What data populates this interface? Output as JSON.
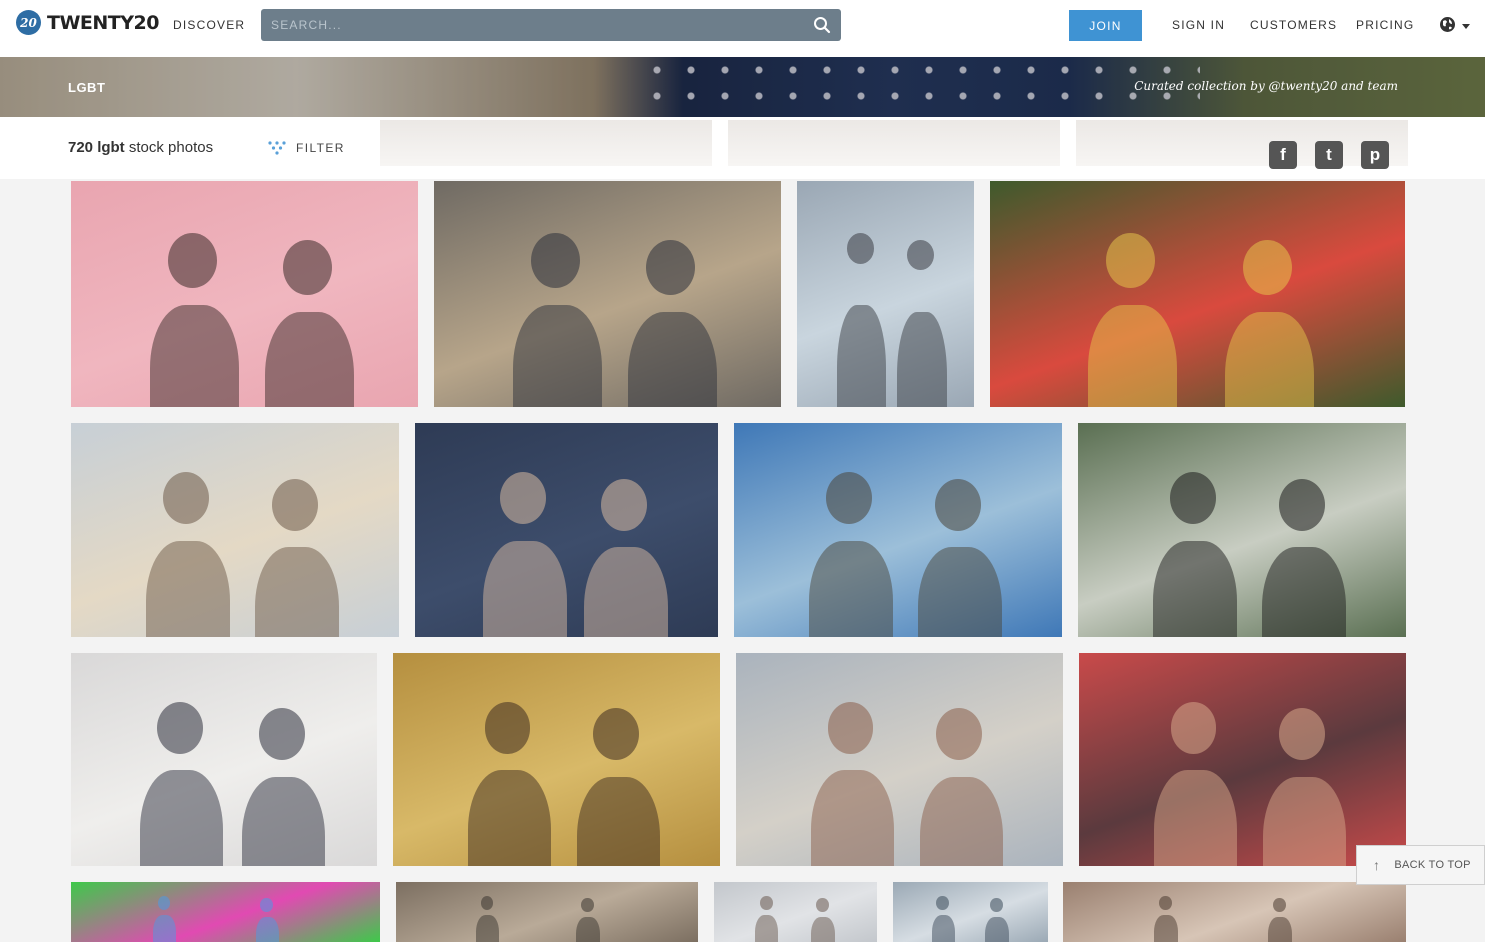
{
  "nav": {
    "logo_badge": "20",
    "logo_text": "TWENTY20",
    "discover": "DISCOVER",
    "search_placeholder": "SEARCH...",
    "join": "JOIN",
    "sign_in": "SIGN IN",
    "customers": "CUSTOMERS",
    "pricing": "PRICING"
  },
  "banner": {
    "title": "LGBT",
    "credit": "Curated collection by @twenty20 and team"
  },
  "subbar": {
    "count": "720 lgbt",
    "count_suffix": "stock photos",
    "filter": "FILTER",
    "social": [
      {
        "name": "facebook",
        "glyph": "f"
      },
      {
        "name": "twitter",
        "glyph": "t"
      },
      {
        "name": "pinterest",
        "glyph": "p"
      }
    ]
  },
  "back_to_top": "BACK TO TOP",
  "photos": [
    {
      "name": "photo-couple-pink-wall",
      "colors": [
        "#e9a5b0",
        "#f0b6bf",
        "#3a2a28"
      ]
    },
    {
      "name": "photo-couple-cafe",
      "colors": [
        "#6f6a63",
        "#b7a58a",
        "#2c2f3a"
      ]
    },
    {
      "name": "photo-portrait-glasses",
      "colors": [
        "#9aa7b4",
        "#c9d5de",
        "#3a3d44"
      ]
    },
    {
      "name": "photo-pride-crowd",
      "colors": [
        "#3e5a2c",
        "#d94a3e",
        "#e6c34a"
      ]
    },
    {
      "name": "photo-couple-coast",
      "colors": [
        "#c7cfd6",
        "#e4d9c5",
        "#6d5a48"
      ]
    },
    {
      "name": "photo-kiss-blue-wall",
      "colors": [
        "#2e3b55",
        "#3d4d6b",
        "#d7b9a1"
      ]
    },
    {
      "name": "photo-couple-sunset",
      "colors": [
        "#3f78b7",
        "#9cbfd9",
        "#4a463a"
      ]
    },
    {
      "name": "photo-grooms-tuxedo",
      "colors": [
        "#5a6f52",
        "#c8cdc2",
        "#1c1c1c"
      ]
    },
    {
      "name": "photo-party-balloons",
      "colors": [
        "#d9d8d8",
        "#efeeec",
        "#2e2f3d"
      ]
    },
    {
      "name": "photo-couple-field",
      "colors": [
        "#b58f3f",
        "#d8b968",
        "#3e2b20"
      ]
    },
    {
      "name": "photo-pride-parade-woman",
      "colors": [
        "#aab3bd",
        "#d4d0c8",
        "#8a5e4a"
      ]
    },
    {
      "name": "photo-bold-arm",
      "colors": [
        "#c94a4a",
        "#5b3a3e",
        "#d7a88a"
      ]
    },
    {
      "name": "photo-painted-hands",
      "colors": [
        "#3ec94a",
        "#e14ab2",
        "#4a9be3"
      ]
    },
    {
      "name": "photo-street-crowd",
      "colors": [
        "#7c6f61",
        "#b9aa98",
        "#3a3530"
      ]
    },
    {
      "name": "photo-city-street",
      "colors": [
        "#c3c7cc",
        "#e1e3e6",
        "#6a5a50"
      ]
    },
    {
      "name": "photo-reebok-cap",
      "colors": [
        "#9ba9b5",
        "#d6dde3",
        "#3b4a5a"
      ]
    },
    {
      "name": "photo-crowd-closeup",
      "colors": [
        "#9a8070",
        "#d7c5b6",
        "#4a3a30"
      ]
    }
  ]
}
